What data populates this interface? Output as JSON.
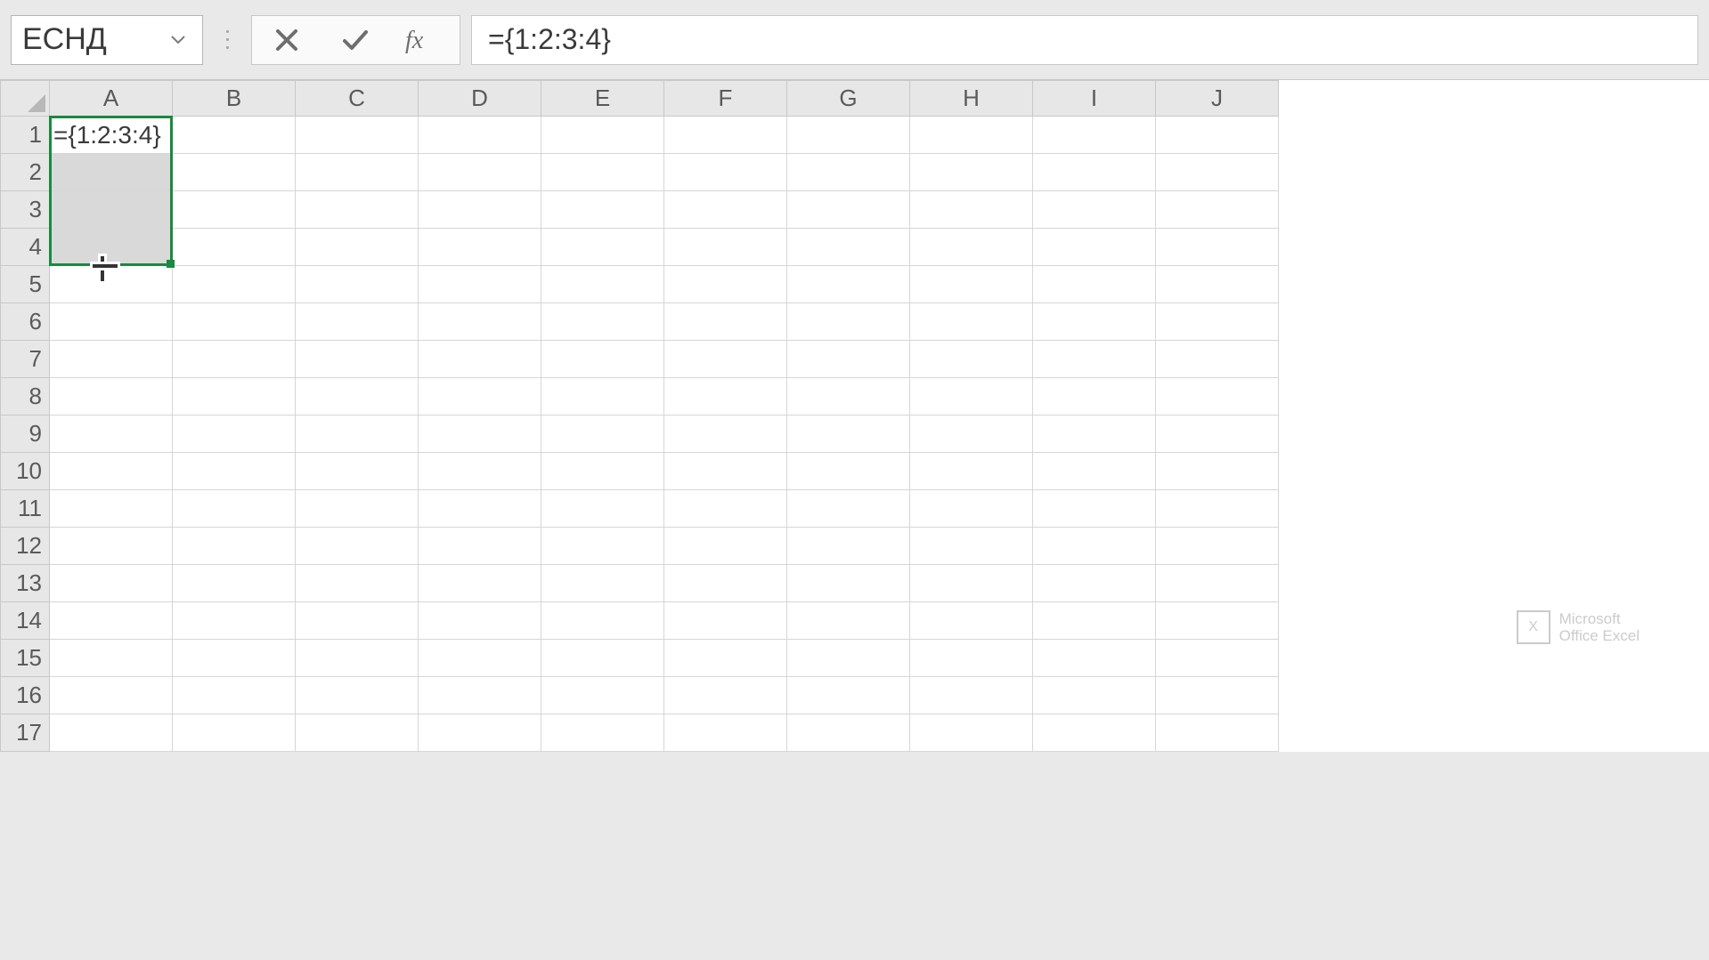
{
  "namebox": {
    "value": "ЕСНД"
  },
  "formula_bar": {
    "value": "={1:2:3:4}"
  },
  "columns": [
    "A",
    "B",
    "C",
    "D",
    "E",
    "F",
    "G",
    "H",
    "I",
    "J"
  ],
  "rows": [
    "1",
    "2",
    "3",
    "4",
    "5",
    "6",
    "7",
    "8",
    "9",
    "10",
    "11",
    "12",
    "13",
    "14",
    "15",
    "16",
    "17"
  ],
  "cells": {
    "A1": "={1:2:3:4}"
  },
  "selection": {
    "start": "A1",
    "end": "A4"
  },
  "cursor_at": "A4",
  "watermark": {
    "line1": "Microsoft",
    "line2": "Office Excel",
    "logo_letter": "X"
  }
}
